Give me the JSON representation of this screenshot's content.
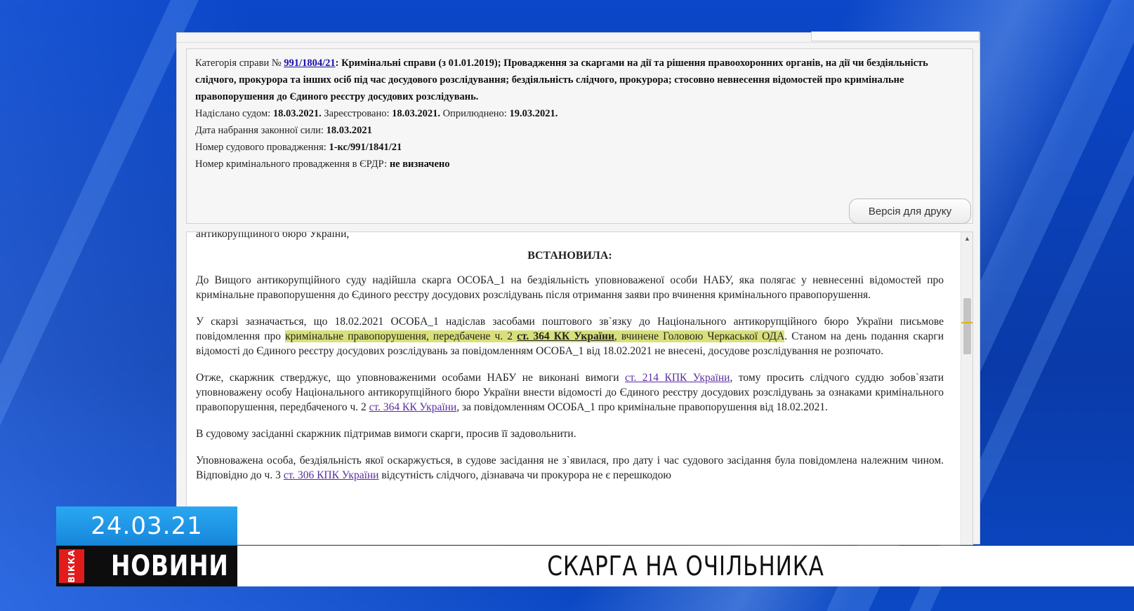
{
  "case_meta": {
    "category_prefix": "Категорія справи № ",
    "case_number_link": "991/1804/21",
    "category_desc": ": Кримінальні справи (з 01.01.2019); Провадження за скаргами на дії та рішення правоохоронних органів, на дії чи бездіяльність слідчого, прокурора та інших осіб під час досудового розслідування; бездіяльність слідчого, прокурора; стосовно невнесення відомостей про кримінальне правопорушення до Єдиного реєстру досудових розслідувань.",
    "sent_label": "Надіслано судом: ",
    "sent_value": "18.03.2021.",
    "registered_label": " Зареєстровано: ",
    "registered_value": "18.03.2021.",
    "published_label": " Оприлюднено: ",
    "published_value": "19.03.2021.",
    "effective_label": "Дата набрання законної сили: ",
    "effective_value": "18.03.2021",
    "proceeding_label": "Номер судового провадження: ",
    "proceeding_value": "1-кс/991/1841/21",
    "erdr_label": "Номер кримінального провадження в ЄРДР: ",
    "erdr_value": "не визначено"
  },
  "print_button": "Версія для друку",
  "document": {
    "line0": "антикорупційного бюро України,",
    "heading": "ВСТАНОВИЛА:",
    "p1": "До Вищого антикорупційного суду надійшла скарга  ОСОБА_1  на бездіяльність уповноваженої особи НАБУ, яка полягає у невнесенні відомостей про кримінальне правопорушення до Єдиного реєстру досудових розслідувань після отримання заяви про вчинення кримінального правопорушення.",
    "p2_a": "У скарзі зазначається, що 18.02.2021  ОСОБА_1  надіслав засобами поштового зв`язку до Національного антикорупційного бюро України письмове повідомлення про ",
    "p2_hl1": "кримінальне правопорушення, передбачене ч. 2 ",
    "p2_hl_link": "ст. 364 КК України",
    "p2_hl2": ", вчинене Головою Черкаської ОДА",
    "p2_b": ". Станом на день подання скарги відомості до Єдиного реєстру досудових розслідувань за повідомленням ОСОБА_1 від 18.02.2021 не внесені, досудове розслідування не розпочато.",
    "p3_a": "Отже, скаржник стверджує, що уповноваженими особами НАБУ не виконані вимоги ",
    "p3_link1": "ст. 214 КПК України",
    "p3_b": ", тому просить слідчого суддю зобов`язати уповноважену особу Національного антикорупційного бюро України внести відомості до Єдиного реєстру досудових розслідувань за ознаками кримінального правопорушення, передбаченого ч. 2 ",
    "p3_link2": "ст. 364 КК України",
    "p3_c": ", за повідомленням ОСОБА_1 про кримінальне правопорушення від 18.02.2021.",
    "p4": "В судовому засіданні скаржник підтримав вимоги скарги, просив її задовольнити.",
    "p5_a": "Уповноважена особа, бездіяльність якої оскаржується, в судове засідання не з`явилася, про дату і час судового засідання була повідомлена належним чином. Відповідно до ч. 3 ",
    "p5_link": "ст. 306 КПК України",
    "p5_b": " відсутність слідчого, дізнавача чи прокурора не є перешкодою"
  },
  "broadcast": {
    "date": "24.03.21",
    "logo": "ВІККА",
    "news_label": "НОВИНИ",
    "headline": "СКАРГА НА ОЧІЛЬНИКА"
  },
  "colors": {
    "backdrop_blue": "#0a3fb8",
    "date_blue": "#1f97e6",
    "logo_red": "#e21b1b",
    "highlight": "#d9e07a",
    "link": "#1a0dab"
  }
}
